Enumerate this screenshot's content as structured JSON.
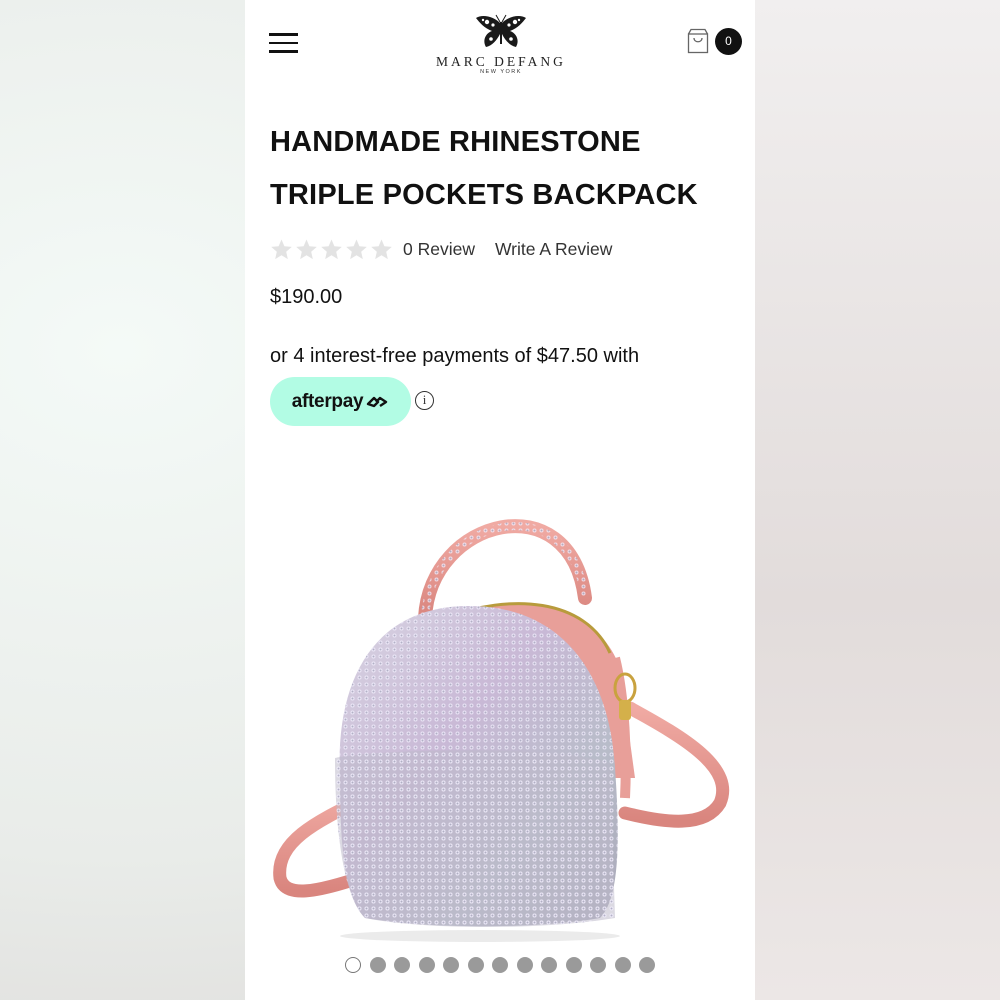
{
  "header": {
    "menu_icon": "hamburger-menu-icon",
    "brand": {
      "name": "MARC DEFANG",
      "sub": "NEW YORK",
      "icon": "butterfly-icon"
    },
    "cart": {
      "icon": "shopping-bag-icon",
      "count": "0"
    }
  },
  "product": {
    "title": "HANDMADE RHINESTONE TRIPLE POCKETS BACKPACK",
    "rating": {
      "value": 0,
      "max": 5,
      "review_count_label": "0 Review",
      "write_review_label": "Write A Review"
    },
    "price": "$190.00",
    "installments_text": "or 4 interest-free payments of $47.50 with",
    "afterpay": {
      "label": "afterpay",
      "icon": "afterpay-arrows-icon",
      "info_icon": "info-icon",
      "info_glyph": "i"
    }
  },
  "gallery": {
    "image_count": 13,
    "active_index": 0
  },
  "colors": {
    "afterpay_mint": "#b2fce4",
    "text": "#111111",
    "star_empty": "#e3e3e3",
    "strap_pink": "#e79a93"
  }
}
